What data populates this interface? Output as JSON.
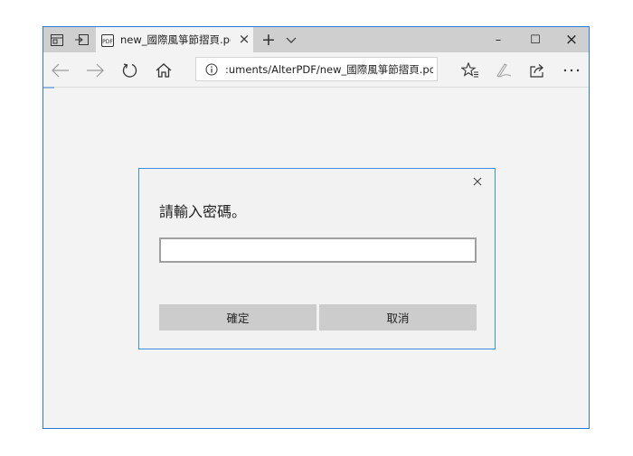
{
  "titlebar": {
    "tab_title": "new_國際風箏節摺頁.pc",
    "tab_close": "×",
    "new_tab": "+",
    "minimize": "–",
    "maximize": "☐",
    "close": "×"
  },
  "navbar": {
    "address": ":uments/AlterPDF/new_國際風箏節摺頁.pdf"
  },
  "dialog": {
    "prompt": "請輸入密碼。",
    "password_value": "",
    "ok_label": "確定",
    "cancel_label": "取消"
  },
  "colors": {
    "accent": "#2b7bd6",
    "titlebar_bg": "#cfcfcf",
    "page_bg": "#f3f3f3",
    "button_bg": "#cccccc"
  },
  "icons": {
    "tab_manager": "tab-manager-icon",
    "set_aside": "set-aside-tabs-icon",
    "pdf_favicon": "pdf-favicon-icon",
    "tab_list": "chevron-down-icon",
    "back": "back-arrow-icon",
    "forward": "forward-arrow-icon",
    "refresh": "refresh-icon",
    "home": "home-icon",
    "info": "info-icon",
    "favorites": "favorites-icon",
    "notes": "pen-notes-icon",
    "share": "share-icon",
    "more": "more-icon",
    "dialog_close": "close-icon"
  }
}
